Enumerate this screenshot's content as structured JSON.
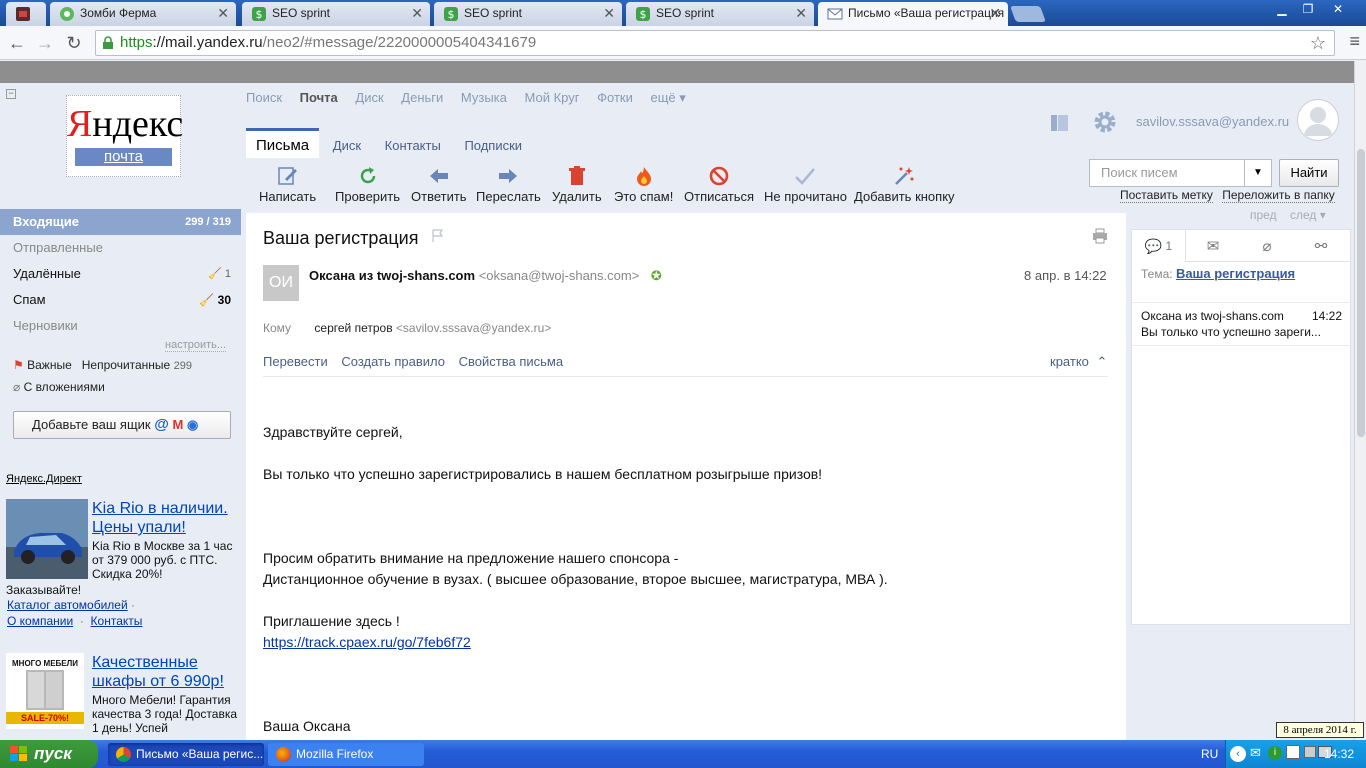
{
  "browser": {
    "tabs": [
      {
        "label": "Зомби Ферма",
        "active": false
      },
      {
        "label": "SEO sprint",
        "active": false
      },
      {
        "label": "SEO sprint",
        "active": false
      },
      {
        "label": "SEO sprint",
        "active": false
      },
      {
        "label": "Письмо «Ваша регистрация",
        "active": true
      }
    ],
    "url_scheme": "https",
    "url_host": "://mail.yandex.ru",
    "url_path": "/neo2/#message/2220000005404341679"
  },
  "logo": {
    "brand": "Яндекс",
    "sub": "почта"
  },
  "services": [
    "Поиск",
    "Почта",
    "Диск",
    "Деньги",
    "Музыка",
    "Мой Круг",
    "Фотки",
    "ещё ▾"
  ],
  "sections": [
    "Письма",
    "Диск",
    "Контакты",
    "Подписки"
  ],
  "user": {
    "email": "savilov.sssava@yandex.ru"
  },
  "actions": [
    "Написать",
    "Проверить",
    "Ответить",
    "Переслать",
    "Удалить",
    "Это спам!",
    "Отписаться",
    "Не прочитано",
    "Добавить кнопку"
  ],
  "search": {
    "placeholder": "Поиск писем",
    "button": "Найти"
  },
  "action_links": [
    "Поставить метку",
    "Переложить в папку"
  ],
  "prevnext": {
    "prev": "пред",
    "next": "след"
  },
  "folders": [
    {
      "name": "Входящие",
      "count": "299 / 319"
    },
    {
      "name": "Отправленные",
      "count": ""
    },
    {
      "name": "Удалённые",
      "count": "1"
    },
    {
      "name": "Спам",
      "count": "30"
    },
    {
      "name": "Черновики",
      "count": ""
    }
  ],
  "configure": "настроить...",
  "labels": {
    "important": "Важные",
    "unread": "Непрочитанные",
    "unread_count": "299",
    "attachments": "С вложениями"
  },
  "add_box": "Добавьте ваш ящик",
  "direct": "Яндекс.Директ",
  "ads": [
    {
      "title": "Kia Rio в наличии. Цены упали!",
      "text": "Kia Rio в Москве за 1 час от 379 000 руб. с ПТС. Скидка 20%!",
      "cont": "Заказывайте!",
      "links": [
        "Каталог автомобилей",
        "О компании",
        "Контакты"
      ]
    },
    {
      "title": "Качественные шкафы от 6 990р!",
      "text": "Много Мебели! Гарантия качества 3 года! Доставка 1 день! Успей",
      "brand": "МНОГО МЕБЕЛИ",
      "sale": "SALE-70%!"
    }
  ],
  "message": {
    "subject": "Ваша регистрация",
    "avatar": "ОИ",
    "from_name": "Оксана из twoj-shans.com",
    "from_email": "<oksana@twoj-shans.com>",
    "date": "8 апр. в 14:22",
    "to_label": "Кому",
    "to_name": "сергей петров",
    "to_email": "<savilov.sssava@yandex.ru>",
    "tools": [
      "Перевести",
      "Создать правило",
      "Свойства письма"
    ],
    "brief": "кратко",
    "body": {
      "greet": "Здравствуйте сергей,",
      "l1": "Вы только что успешно зарегистрировались в нашем бесплатном розыгрыше призов!",
      "l2": "Просим обратить внимание на предложение нашего спонсора -",
      "l3": "Дистанционное обучение в вузах. ( высшее образование, второе высшее, магистратура, МВА ).",
      "l4": "Приглашение здесь !",
      "link": "https://track.cpaex.ru/go/7feb6f72",
      "sign": "Ваша Оксана"
    }
  },
  "thread": {
    "count": "1",
    "tema_label": "Тема:",
    "tema": "Ваша регистрация",
    "item_sender": "Оксана из twoj-shans.com",
    "item_time": "14:22",
    "item_preview": "Вы только что успешно зареги..."
  },
  "tooltip": "8 апреля 2014 г.",
  "taskbar": {
    "start": "пуск",
    "tasks": [
      "Письмо «Ваша регис...",
      "Mozilla Firefox"
    ],
    "lang": "RU",
    "clock": "14:32"
  },
  "colors": {
    "accent": "#3c67b3",
    "folder_active": "#8ca5ce",
    "link": "#0044bb",
    "taskbar": "#245dd7"
  }
}
